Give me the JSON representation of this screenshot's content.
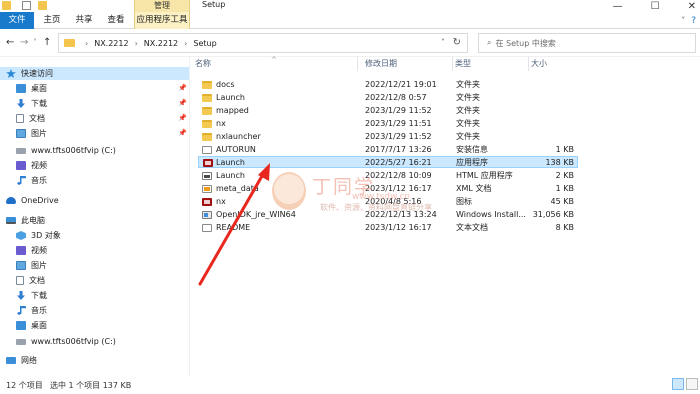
{
  "window": {
    "title": "Setup",
    "context_tab": "管理",
    "controls": [
      "—",
      "☐",
      "✕"
    ]
  },
  "ribbon": {
    "tabs": [
      "文件",
      "主页",
      "共享",
      "查看",
      "应用程序工具"
    ],
    "help": "?"
  },
  "address_bar": {
    "back": "←",
    "forward": "→",
    "up_recent": "˅",
    "up": "↑",
    "path": [
      "NX.2212",
      "NX.2212",
      "Setup"
    ],
    "refresh": "↻"
  },
  "search": {
    "placeholder": "在 Setup 中搜索"
  },
  "sidebar": {
    "items": [
      {
        "label": "快速访问",
        "icon": "star-icon",
        "pinned": false
      },
      {
        "label": "桌面",
        "icon": "desktop-icon",
        "pinned": true
      },
      {
        "label": "下载",
        "icon": "download-icon",
        "pinned": true
      },
      {
        "label": "文档",
        "icon": "document-icon",
        "pinned": true
      },
      {
        "label": "图片",
        "icon": "picture-icon",
        "pinned": true
      },
      {
        "label": "www.tfts006tfvip (C:)",
        "icon": "drive-icon",
        "pinned": false
      },
      {
        "label": "视频",
        "icon": "video-icon",
        "pinned": false
      },
      {
        "label": "音乐",
        "icon": "music-icon",
        "pinned": false
      },
      {
        "label": "OneDrive",
        "icon": "cloud-icon",
        "pinned": false
      },
      {
        "label": "此电脑",
        "icon": "computer-icon",
        "pinned": false
      },
      {
        "label": "3D 对象",
        "icon": "3d-icon",
        "pinned": false
      },
      {
        "label": "视频",
        "icon": "video-icon",
        "pinned": false
      },
      {
        "label": "图片",
        "icon": "picture-icon",
        "pinned": false
      },
      {
        "label": "文档",
        "icon": "document-icon",
        "pinned": false
      },
      {
        "label": "下载",
        "icon": "download-icon",
        "pinned": false
      },
      {
        "label": "音乐",
        "icon": "music-icon",
        "pinned": false
      },
      {
        "label": "桌面",
        "icon": "desktop-icon",
        "pinned": false
      },
      {
        "label": "www.tfts006tfvip (C:)",
        "icon": "drive-icon",
        "pinned": false
      },
      {
        "label": "网络",
        "icon": "network-icon",
        "pinned": false
      }
    ]
  },
  "columns": {
    "name": "名称",
    "modified": "修改日期",
    "type": "类型",
    "size": "大小",
    "sort_indicator": "^"
  },
  "files": [
    {
      "name": "docs",
      "modified": "2022/12/21 19:01",
      "type": "文件夹",
      "size": "",
      "icon": "folder-icon"
    },
    {
      "name": "Launch",
      "modified": "2022/12/8 0:57",
      "type": "文件夹",
      "size": "",
      "icon": "folder-icon"
    },
    {
      "name": "mapped",
      "modified": "2023/1/29 11:52",
      "type": "文件夹",
      "size": "",
      "icon": "folder-icon"
    },
    {
      "name": "nx",
      "modified": "2023/1/29 11:51",
      "type": "文件夹",
      "size": "",
      "icon": "folder-icon"
    },
    {
      "name": "nxlauncher",
      "modified": "2023/1/29 11:52",
      "type": "文件夹",
      "size": "",
      "icon": "folder-icon"
    },
    {
      "name": "AUTORUN",
      "modified": "2017/7/17 13:26",
      "type": "安装信息",
      "size": "1 KB",
      "icon": "file-icon"
    },
    {
      "name": "Launch",
      "modified": "2022/5/27 16:21",
      "type": "应用程序",
      "size": "138 KB",
      "icon": "exe-icon",
      "selected": true
    },
    {
      "name": "Launch",
      "modified": "2022/12/8 10:09",
      "type": "HTML 应用程序",
      "size": "2 KB",
      "icon": "shortcut-icon"
    },
    {
      "name": "meta_data",
      "modified": "2023/1/12 16:17",
      "type": "XML 文档",
      "size": "1 KB",
      "icon": "xml-icon"
    },
    {
      "name": "nx",
      "modified": "2020/4/8 5:16",
      "type": "图标",
      "size": "45 KB",
      "icon": "exe-icon"
    },
    {
      "name": "OpenJDK_jre_WIN64",
      "modified": "2022/12/13 13:24",
      "type": "Windows Install...",
      "size": "31,056 KB",
      "icon": "msi-icon"
    },
    {
      "name": "README",
      "modified": "2023/1/12 16:17",
      "type": "文本文档",
      "size": "8 KB",
      "icon": "file-icon"
    }
  ],
  "status": {
    "item_count": "12 个项目",
    "selection": "选中 1 个项目  137 KB"
  },
  "watermark": {
    "title": "丁同学",
    "url": "www.tsdw.cn",
    "slogan": "软件、资源、资料网盘直链分享"
  },
  "colors": {
    "accent": "#1979ca",
    "selection": "#cce8ff",
    "arrow": "#e8281f",
    "context_tab": "#fcf1c4"
  }
}
